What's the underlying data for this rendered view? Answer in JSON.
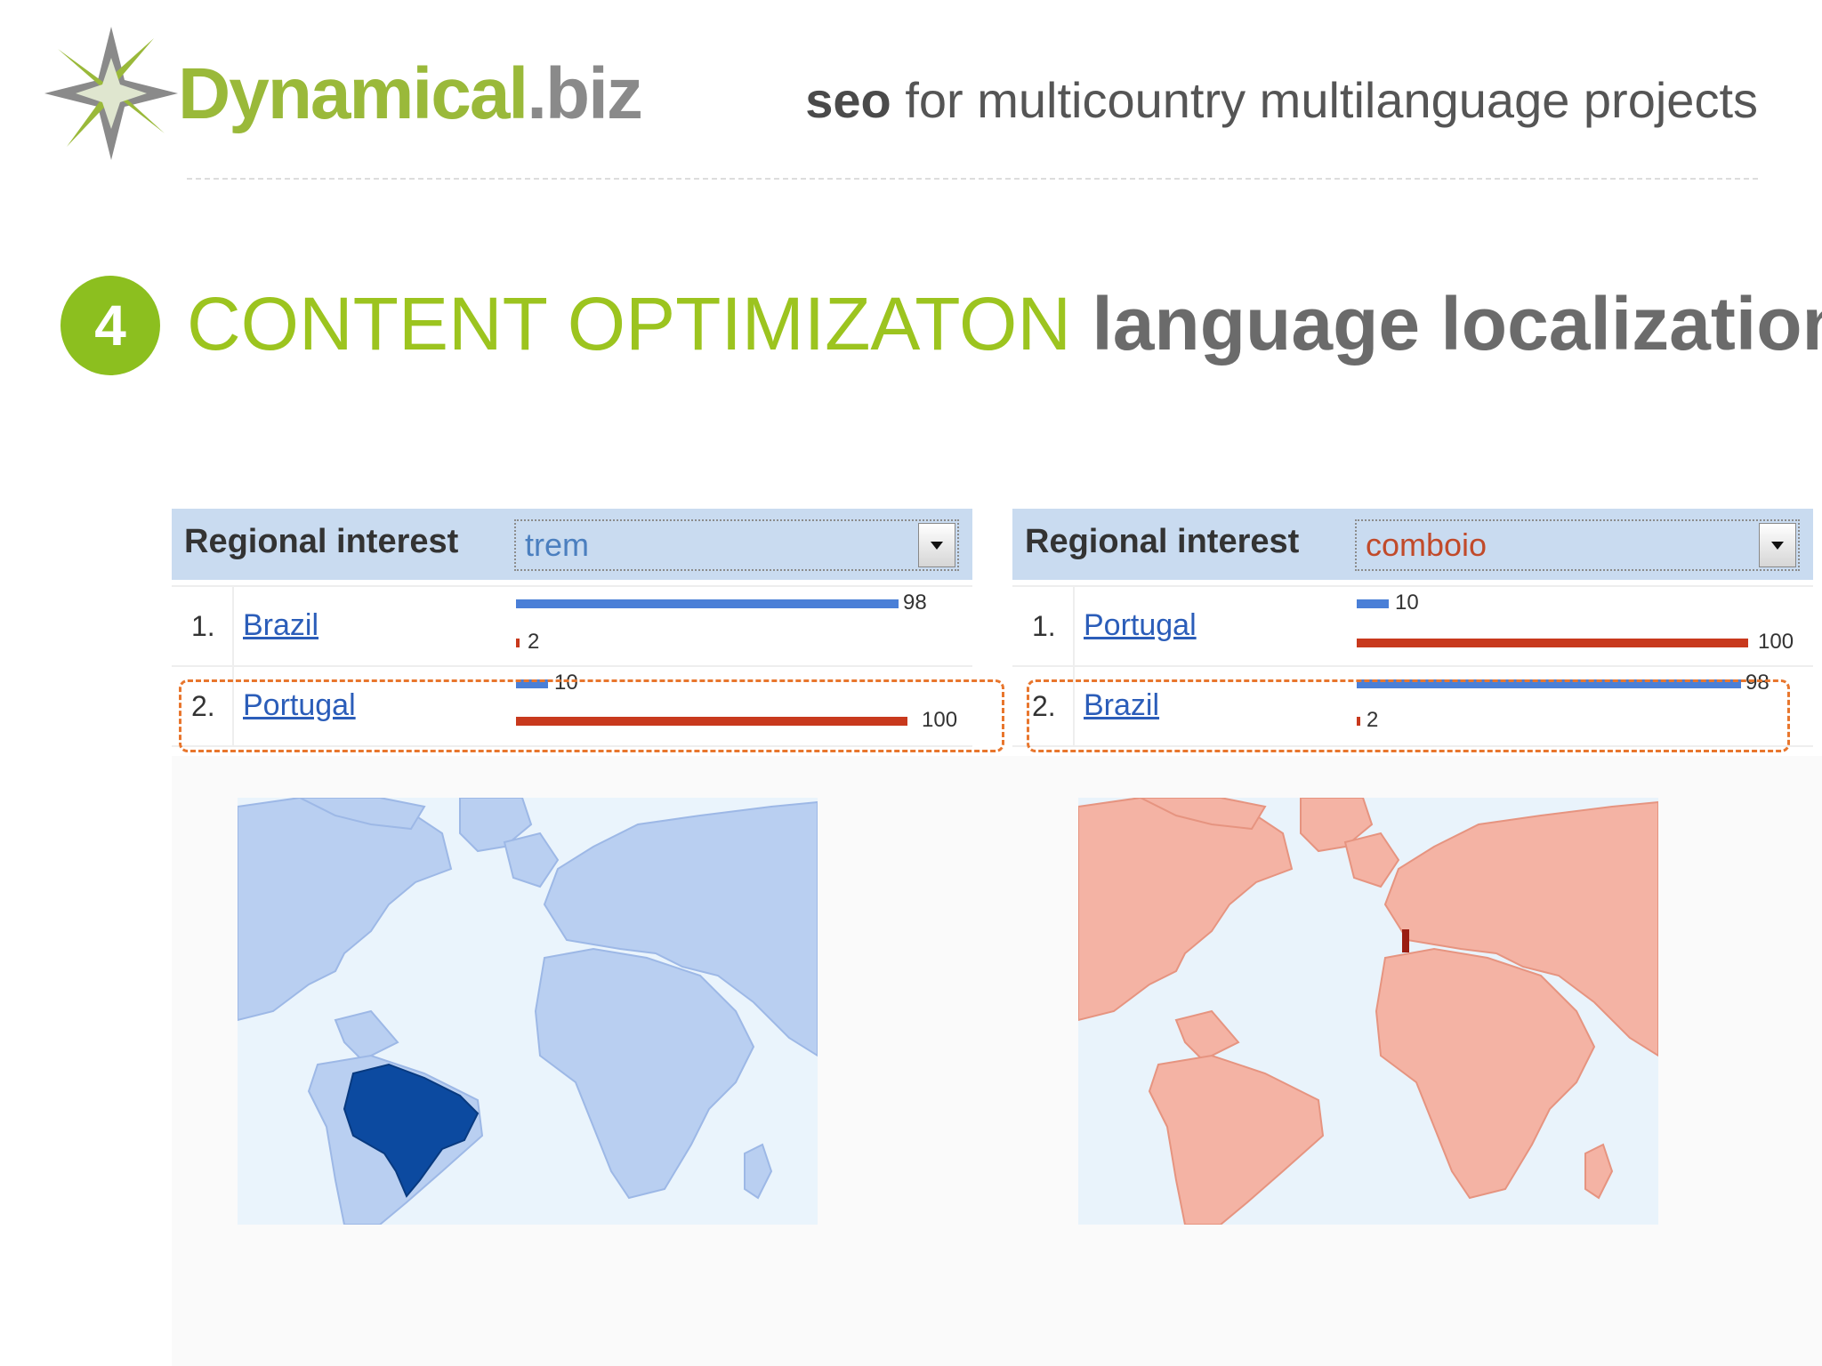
{
  "header": {
    "logo_name": "Dynamical",
    "logo_tld": ".biz",
    "tagline_bold": "seo",
    "tagline_rest": " for multicountry multilanguage projects"
  },
  "section": {
    "number": "4",
    "title": "CONTENT OPTIMIZATON",
    "subtitle": "language localization"
  },
  "panels": [
    {
      "title": "Regional interest",
      "term": "trem",
      "rows": [
        {
          "rank": "1.",
          "country": "Brazil",
          "blue": 98,
          "red": 2
        },
        {
          "rank": "2.",
          "country": "Portugal",
          "blue": 10,
          "red": 100
        }
      ],
      "highlight_row": 2,
      "map_highlight": "Brazil",
      "map_colors": {
        "base": "#b9cff1",
        "highlight": "#0c4aa0",
        "ocean": "#eaf4fc"
      }
    },
    {
      "title": "Regional interest",
      "term": "comboio",
      "rows": [
        {
          "rank": "1.",
          "country": "Portugal",
          "blue": 10,
          "red": 100
        },
        {
          "rank": "2.",
          "country": "Brazil",
          "blue": 98,
          "red": 2
        }
      ],
      "highlight_row": 2,
      "map_highlight": "Portugal",
      "map_colors": {
        "base": "#f4b3a4",
        "highlight": "#9a1d12",
        "ocean": "#e9f3fb"
      }
    }
  ],
  "colors": {
    "accent_green": "#9cc41f",
    "header_blue": "#c9dbf0",
    "bar_blue": "#4a7fd7",
    "bar_red": "#c8391d",
    "highlight_dash": "#e8762d"
  },
  "bar_labels": {
    "left_row1_blue": "98",
    "left_row1_red": "2",
    "left_row2_blue": "10",
    "left_row2_red": "100",
    "right_row1_blue": "10",
    "right_row1_red": "100",
    "right_row2_blue": "98",
    "right_row2_red": "2"
  }
}
